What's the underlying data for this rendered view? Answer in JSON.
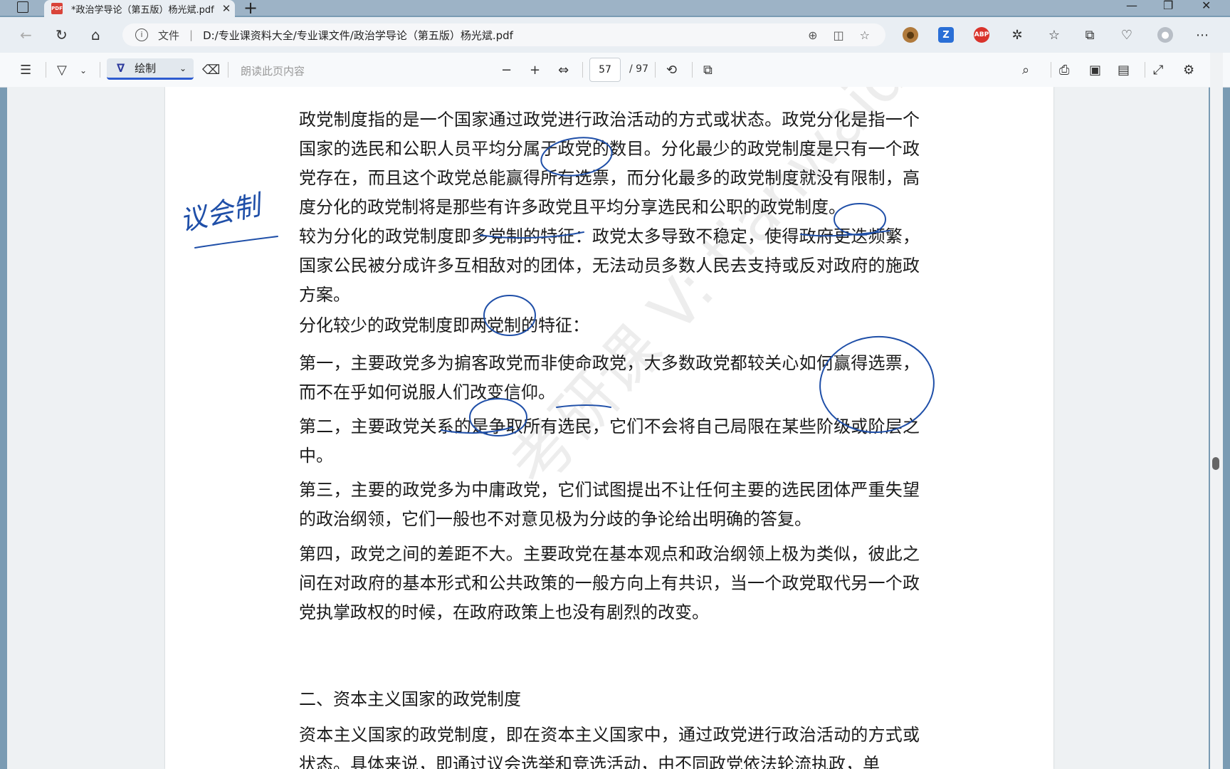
{
  "browser": {
    "tab_title": "*政治学导论（第五版）杨光斌.pdf",
    "tab_close": "✕",
    "new_tab": "+",
    "address_prefix": "文件",
    "address_url": "D:/专业课资料大全/专业课文件/政治学导论（第五版）杨光斌.pdf"
  },
  "pdf_toolbar": {
    "draw_label": "绘制",
    "read_aloud_label": "朗读此页内容",
    "current_page": "57",
    "total_pages": "/ 97"
  },
  "document": {
    "paragraphs": [
      "政党制度指的是一个国家通过政党进行政治活动的方式或状态。政党分化是指一个国家的选民和公职人员平均分属于政党的数目。分化最少的政党制度是只有一个政党存在，而且这个政党总能赢得所有选票，而分化最多的政党制度就没有限制，高度分化的政党制将是那些有许多政党且平均分享选民和公职的政党制度。",
      "较为分化的政党制度即多党制的特征：政党太多导致不稳定，使得政府更迭频繁，国家公民被分成许多互相敌对的团体，无法动员多数人民去支持或反对政府的施政方案。",
      "分化较少的政党制度即两党制的特征：",
      "第一，主要政党多为掮客政党而非使命政党，大多数政党都较关心如何赢得选票，而不在乎如何说服人们改变信仰。",
      "第二，主要政党关系的是争取所有选民，它们不会将自己局限在某些阶级或阶层之中。",
      "第三，主要的政党多为中庸政党，它们试图提出不让任何主要的选民团体严重失望的政治纲领，它们一般也不对意见极为分歧的争论给出明确的答复。",
      "第四，政党之间的差距不大。主要政党在基本观点和政治纲领上极为类似，彼此之间在对政府的基本形式和公共政策的一般方向上有共识，当一个政党取代另一个政党执掌政权的时候，在政府政策上也没有剧烈的改变。"
    ],
    "heading": "二、资本主义国家的政党制度",
    "last_paragraph": "资本主义国家的政党制度，即在资本主义国家中，通过政党进行政治活动的方式或状态。具体来说，即通过议会选举和竞选活动，由不同政党依法轮流执政，单",
    "handwritten_note": "议会制",
    "watermark": "考研课 V: tianwaidelan"
  },
  "colors": {
    "ink": "#1f4fa8",
    "accent": "#2d5bd0"
  }
}
